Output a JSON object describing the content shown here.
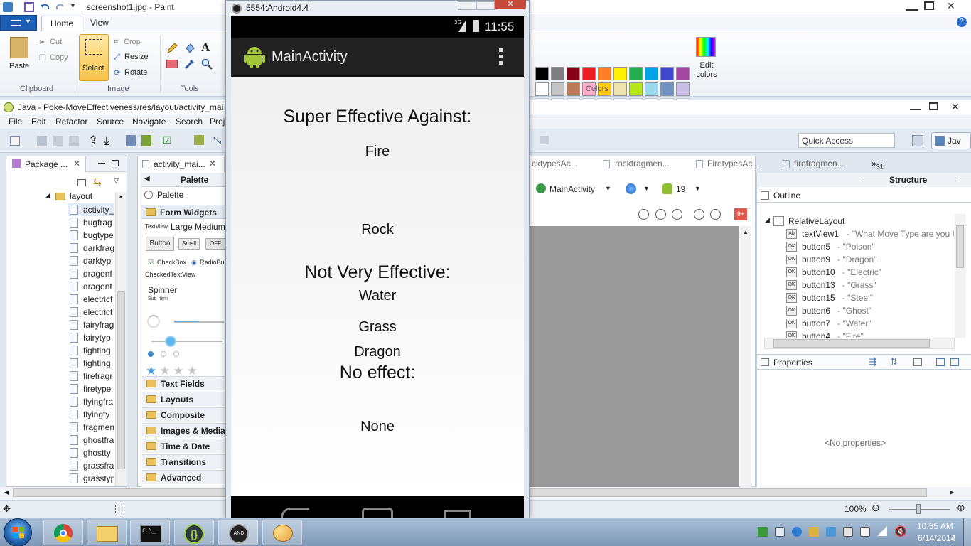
{
  "paint": {
    "title": "screenshot1.jpg - Paint",
    "tabs": [
      "Home",
      "View"
    ],
    "ribbon": {
      "paste": "Paste",
      "cut": "Cut",
      "copy": "Copy",
      "select": "Select",
      "crop": "Crop",
      "resize": "Resize",
      "rotate": "Rotate",
      "edit_colors": "Edit colors",
      "groups": [
        "Clipboard",
        "Image",
        "Tools",
        "Colors"
      ]
    },
    "colors_row1": [
      "#000000",
      "#7f7f7f",
      "#880015",
      "#ed1c24",
      "#ff7f27",
      "#fff200",
      "#22b14c",
      "#00a2e8",
      "#3f48cc",
      "#a349a4"
    ],
    "colors_row2": [
      "#ffffff",
      "#c3c3c3",
      "#b97a57",
      "#ffaec9",
      "#ffc90e",
      "#efe4b0",
      "#b5e61d",
      "#99d9ea",
      "#7092be",
      "#c8bfe7"
    ]
  },
  "eclipse": {
    "title": "Java - Poke-MoveEffectiveness/res/layout/activity_mai",
    "menu": [
      "File",
      "Edit",
      "Refactor",
      "Source",
      "Navigate",
      "Search",
      "Proj"
    ],
    "quick_access": "Quick Access",
    "perspective": "Jav",
    "package_explorer": {
      "tab": "Package ...",
      "folder": "layout",
      "files": [
        "activity_",
        "bugfrag",
        "bugtype",
        "darkfrag",
        "darktyp",
        "dragonf",
        "dragont",
        "electricf",
        "electrict",
        "fairyfrag",
        "fairytyp",
        "fighting",
        "fighting",
        "firefragr",
        "firetype",
        "flyingfra",
        "flyingty",
        "fragmen",
        "ghostfra",
        "ghostty",
        "grassfra",
        "grasstyp"
      ]
    },
    "editor_tab": "activity_mai...",
    "palette": {
      "header": "Palette",
      "title": "Palette",
      "form_widgets": "Form Widgets",
      "textview": "TextView",
      "large_medium": "Large Medium",
      "button": "Button",
      "small": "Small",
      "off": "OFF",
      "checkbox": "CheckBox",
      "radio": "RadioBu",
      "checked_text": "CheckedTextView",
      "spinner": "Spinner",
      "sub_item": "Sub Item",
      "categories": [
        "Text Fields",
        "Layouts",
        "Composite",
        "Images & Media",
        "Time & Date",
        "Transitions",
        "Advanced"
      ]
    },
    "other_tabs": [
      "cktypesAc...",
      "rockfragmen...",
      "FiretypesAc...",
      "firefragmen..."
    ],
    "overflow_count": "31",
    "layout_toolbar": {
      "activity": "MainActivity",
      "api": "19"
    },
    "error_badge": "9+",
    "structure": {
      "header": "Structure",
      "outline_tab": "Outline",
      "root": "RelativeLayout",
      "items": [
        {
          "icon": "Ab",
          "id": "textView1",
          "desc": "- \"What Move Type are you Us"
        },
        {
          "icon": "OK",
          "id": "button5",
          "desc": "- \"Poison\""
        },
        {
          "icon": "OK",
          "id": "button9",
          "desc": "- \"Dragon\""
        },
        {
          "icon": "OK",
          "id": "button10",
          "desc": "- \"Electric\""
        },
        {
          "icon": "OK",
          "id": "button13",
          "desc": "- \"Grass\""
        },
        {
          "icon": "OK",
          "id": "button15",
          "desc": "- \"Steel\""
        },
        {
          "icon": "OK",
          "id": "button6",
          "desc": "- \"Ghost\""
        },
        {
          "icon": "OK",
          "id": "button7",
          "desc": "- \"Water\""
        },
        {
          "icon": "OK",
          "id": "button4",
          "desc": "- \"Fire\""
        }
      ],
      "properties_tab": "Properties",
      "no_properties": "<No properties>"
    },
    "zoom": "100%"
  },
  "emulator": {
    "title": "5554:Android4.4",
    "status_network": "3G",
    "clock": "11:55",
    "action_title": "MainActivity",
    "content": {
      "super_header": "Super Effective Against:",
      "super_1": "Fire",
      "super_2": "Rock",
      "notvery_header": "Not Very Effective:",
      "notvery_1": "Water",
      "notvery_2": "Grass",
      "notvery_3": "Dragon",
      "noeffect_header": "No effect:",
      "noeffect_1": "None"
    }
  },
  "taskbar": {
    "time": "10:55 AM",
    "date": "6/14/2014",
    "apps": [
      "start-orb",
      "chrome",
      "file-explorer",
      "command-prompt",
      "brackets",
      "android-emulator",
      "paint"
    ]
  }
}
